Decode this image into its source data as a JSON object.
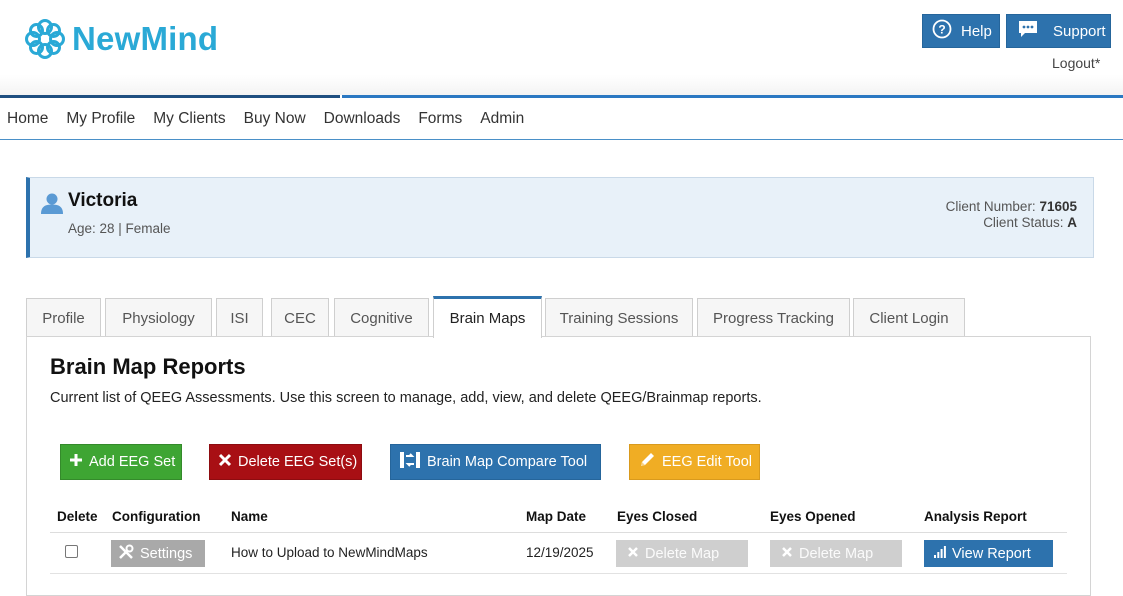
{
  "brand": {
    "name": "NewMind",
    "color": "#2aa9d6"
  },
  "header": {
    "help_label": "Help",
    "support_label": "Support",
    "logout_label": "Logout*"
  },
  "nav": {
    "items": [
      "Home",
      "My Profile",
      "My Clients",
      "Buy Now",
      "Downloads",
      "Forms",
      "Admin"
    ]
  },
  "client": {
    "name": "Victoria",
    "meta": "Age: 28 | Female",
    "number_label": "Client Number:",
    "number": "71605",
    "status_label": "Client Status:",
    "status": "A"
  },
  "tabs": {
    "items": [
      "Profile",
      "Physiology",
      "ISI",
      "CEC",
      "Cognitive",
      "Brain Maps",
      "Training Sessions",
      "Progress Tracking",
      "Client Login"
    ],
    "active": "Brain Maps"
  },
  "panel": {
    "title": "Brain Map Reports",
    "description": "Current list of QEEG Assessments. Use this screen to manage, add, view, and delete QEEG/Brainmap reports."
  },
  "actions": {
    "add_label": "Add EEG Set",
    "delete_label": "Delete EEG Set(s)",
    "compare_label": "Brain Map Compare Tool",
    "edit_label": "EEG Edit Tool"
  },
  "table": {
    "headers": [
      "Delete",
      "Configuration",
      "Name",
      "Map Date",
      "Eyes Closed",
      "Eyes Opened",
      "Analysis Report"
    ],
    "rows": [
      {
        "settings_label": "Settings",
        "name": "How to Upload to NewMindMaps",
        "map_date": "12/19/2025",
        "eyes_closed_label": "Delete Map",
        "eyes_opened_label": "Delete Map",
        "report_label": "View Report"
      }
    ]
  },
  "colors": {
    "primary": "#2d72ad",
    "success": "#3ea533",
    "danger": "#a80f14",
    "warning": "#f0ad24",
    "disabled": "#cfcfcf"
  }
}
